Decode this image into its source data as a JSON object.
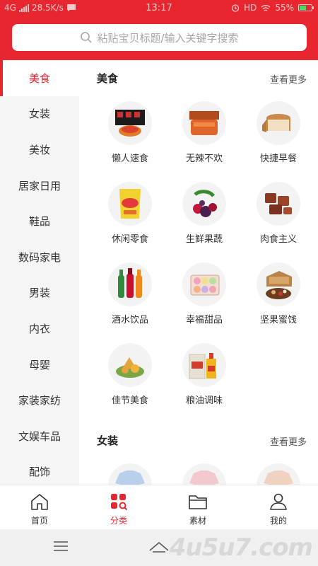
{
  "status_bar": {
    "network": "4G",
    "speed": "28.5K/s",
    "time": "13:17",
    "hd": "HD",
    "battery": "55%",
    "battery_level": 0.55
  },
  "search": {
    "placeholder": "粘贴宝贝标题/输入关键字搜索"
  },
  "sidebar": {
    "items": [
      {
        "label": "美食",
        "active": true
      },
      {
        "label": "女装"
      },
      {
        "label": "美妆"
      },
      {
        "label": "居家日用"
      },
      {
        "label": "鞋品"
      },
      {
        "label": "数码家电"
      },
      {
        "label": "男装"
      },
      {
        "label": "内衣"
      },
      {
        "label": "母婴"
      },
      {
        "label": "家装家纺"
      },
      {
        "label": "文娱车品"
      },
      {
        "label": "配饰"
      }
    ]
  },
  "sections": [
    {
      "title": "美食",
      "more": "查看更多",
      "items": [
        {
          "label": "懒人速食",
          "icon": "instant-food-icon"
        },
        {
          "label": "无辣不欢",
          "icon": "spicy-food-icon"
        },
        {
          "label": "快捷早餐",
          "icon": "bread-icon"
        },
        {
          "label": "休闲零食",
          "icon": "snack-bag-icon"
        },
        {
          "label": "生鲜果蔬",
          "icon": "fruit-icon"
        },
        {
          "label": "肉食主义",
          "icon": "meat-icon"
        },
        {
          "label": "酒水饮品",
          "icon": "drinks-icon"
        },
        {
          "label": "幸福甜品",
          "icon": "macaron-icon"
        },
        {
          "label": "坚果蜜饯",
          "icon": "nuts-icon"
        },
        {
          "label": "佳节美食",
          "icon": "zongzi-icon"
        },
        {
          "label": "粮油调味",
          "icon": "oil-rice-icon"
        }
      ]
    },
    {
      "title": "女装",
      "more": "查看更多",
      "items": [
        {
          "label": "",
          "icon": "blouse-icon"
        },
        {
          "label": "",
          "icon": "coat-icon"
        },
        {
          "label": "",
          "icon": "sweater-icon"
        }
      ]
    }
  ],
  "tabbar": {
    "items": [
      {
        "label": "首页",
        "icon": "home-icon"
      },
      {
        "label": "分类",
        "icon": "category-icon",
        "active": true
      },
      {
        "label": "素材",
        "icon": "folder-icon"
      },
      {
        "label": "我的",
        "icon": "user-icon"
      }
    ]
  },
  "navbar": {
    "watermark": "4u5u7.com"
  },
  "colors": {
    "accent": "#e8262f",
    "sidebar_bg": "#f5f5f5"
  }
}
